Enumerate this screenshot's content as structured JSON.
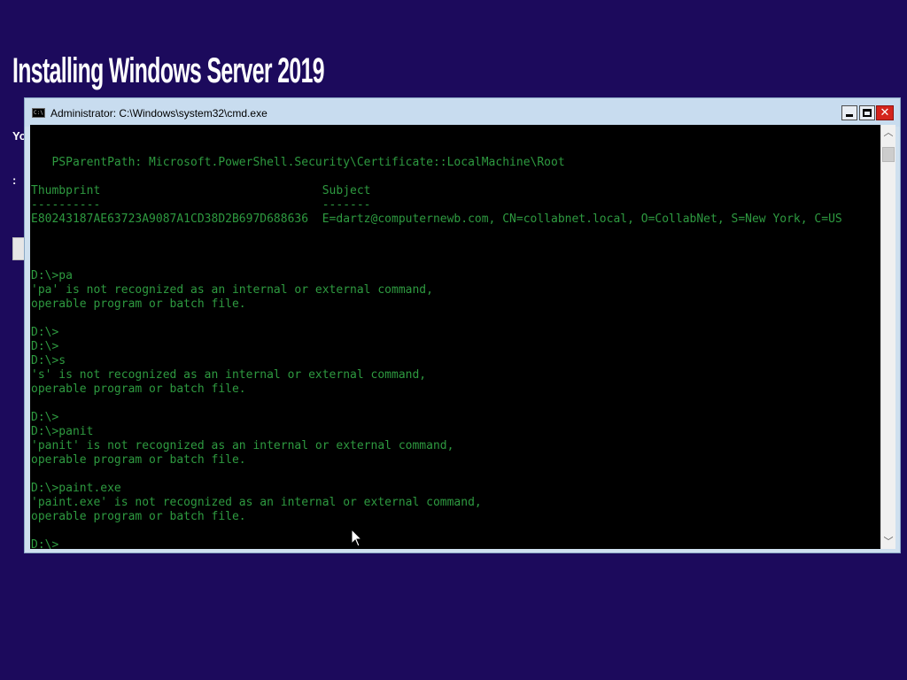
{
  "background": {
    "title": "Installing Windows Server 2019",
    "fragment_1": "Yo",
    "fragment_2": ":"
  },
  "window": {
    "title": "Administrator: C:\\Windows\\system32\\cmd.exe",
    "icon_text": "C:\\"
  },
  "console": {
    "lines": [
      "",
      "",
      "   PSParentPath: Microsoft.PowerShell.Security\\Certificate::LocalMachine\\Root",
      "",
      "Thumbprint                                Subject",
      "----------                                -------",
      "E80243187AE63723A9087A1CD38D2B697D688636  E=dartz@computernewb.com, CN=collabnet.local, O=CollabNet, S=New York, C=US",
      "",
      "",
      "",
      "D:\\>pa",
      "'pa' is not recognized as an internal or external command,",
      "operable program or batch file.",
      "",
      "D:\\>",
      "D:\\>",
      "D:\\>s",
      "'s' is not recognized as an internal or external command,",
      "operable program or batch file.",
      "",
      "D:\\>",
      "D:\\>panit",
      "'panit' is not recognized as an internal or external command,",
      "operable program or batch file.",
      "",
      "D:\\>paint.exe",
      "'paint.exe' is not recognized as an internal or external command,",
      "operable program or batch file.",
      "",
      "D:\\>"
    ]
  },
  "colors": {
    "desktop": "#1c0a5c",
    "console_text": "#2e9a40",
    "console_bg": "#000000"
  },
  "icons": {
    "window": "cmd-icon",
    "minimize": "minimize-icon",
    "maximize": "maximize-icon",
    "close": "close-icon",
    "scroll_up": "chevron-up-icon",
    "scroll_down": "chevron-down-icon",
    "pointer": "mouse-pointer-icon"
  }
}
